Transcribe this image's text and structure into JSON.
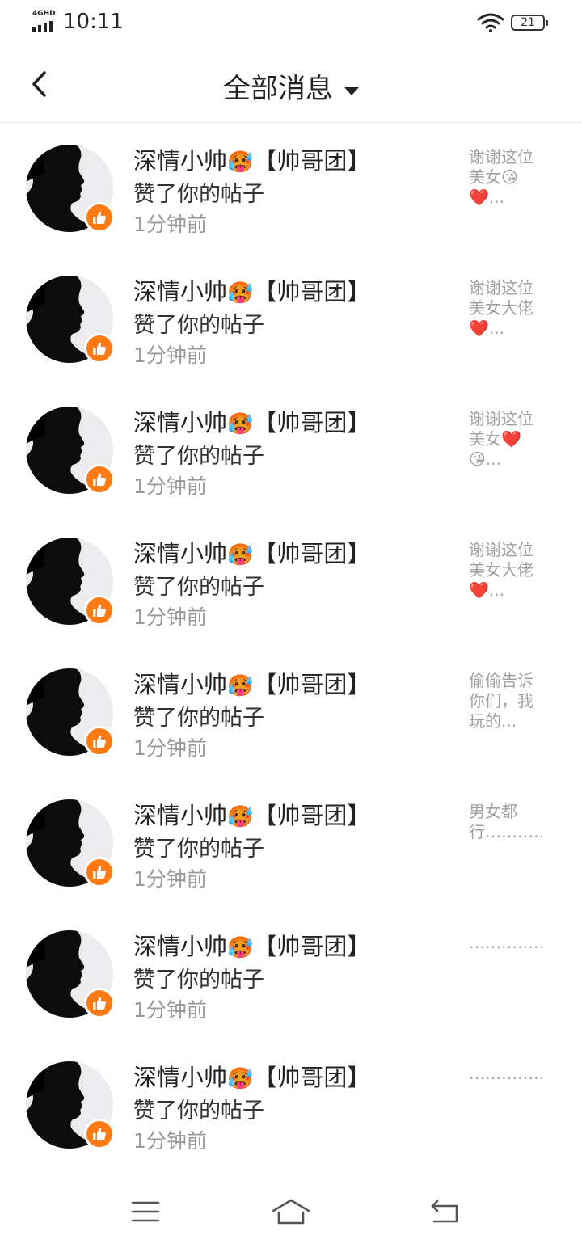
{
  "status_bar": {
    "network": "4GHD",
    "time": "10:11",
    "battery": "21"
  },
  "header": {
    "title": "全部消息"
  },
  "messages": [
    {
      "name": "深情小帅",
      "emoji": "🥵",
      "group": "【帅哥团】",
      "action": "赞了你的帖子",
      "time": "1分钟前",
      "preview": "谢谢这位美女😘❤️..."
    },
    {
      "name": "深情小帅",
      "emoji": "🥵",
      "group": "【帅哥团】",
      "action": "赞了你的帖子",
      "time": "1分钟前",
      "preview": "谢谢这位美女大佬❤️..."
    },
    {
      "name": "深情小帅",
      "emoji": "🥵",
      "group": "【帅哥团】",
      "action": "赞了你的帖子",
      "time": "1分钟前",
      "preview": "谢谢这位美女❤️😘..."
    },
    {
      "name": "深情小帅",
      "emoji": "🥵",
      "group": "【帅哥团】",
      "action": "赞了你的帖子",
      "time": "1分钟前",
      "preview": "谢谢这位美女大佬❤️..."
    },
    {
      "name": "深情小帅",
      "emoji": "🥵",
      "group": "【帅哥团】",
      "action": "赞了你的帖子",
      "time": "1分钟前",
      "preview": "偷偷告诉你们，我玩的..."
    },
    {
      "name": "深情小帅",
      "emoji": "🥵",
      "group": "【帅哥团】",
      "action": "赞了你的帖子",
      "time": "1分钟前",
      "preview": "男女都行…………..."
    },
    {
      "name": "深情小帅",
      "emoji": "🥵",
      "group": "【帅哥团】",
      "action": "赞了你的帖子",
      "time": "1分钟前",
      "preview": "……………………..."
    },
    {
      "name": "深情小帅",
      "emoji": "🥵",
      "group": "【帅哥团】",
      "action": "赞了你的帖子",
      "time": "1分钟前",
      "preview": "……………………..."
    }
  ],
  "icons": {
    "back": "back-arrow-icon",
    "dropdown": "caret-down-icon",
    "like": "thumbs-up-icon",
    "nav_menu": "menu-icon",
    "nav_home": "home-icon",
    "nav_back": "return-icon"
  },
  "colors": {
    "like_badge": "#ff7a12",
    "heart": "#e0142a"
  }
}
